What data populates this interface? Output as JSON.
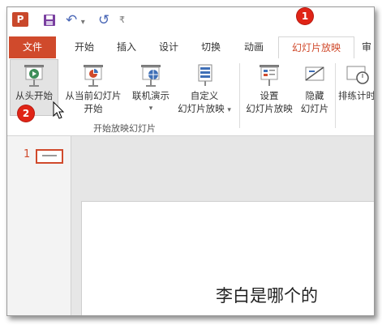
{
  "qat": {
    "logo": "P",
    "undo": "↶",
    "undo_drop": "▾",
    "redo": "↺",
    "customize": "₹"
  },
  "tabs": [
    "文件",
    "开始",
    "插入",
    "设计",
    "切换",
    "动画",
    "幻灯片放映",
    "审"
  ],
  "ribbon": {
    "from_start": "从头开始",
    "from_current_1": "从当前幻灯片",
    "from_current_2": "开始",
    "online_present": "联机演示",
    "online_drop": "▾",
    "custom_1": "自定义",
    "custom_2": "幻灯片放映",
    "custom_drop": "▾",
    "setup_1": "设置",
    "setup_2": "幻灯片放映",
    "hide_1": "隐藏",
    "hide_2": "幻灯片",
    "rehearse": "排练计时",
    "group_label": "开始放映幻灯片"
  },
  "thumbs": {
    "slide_number": "1"
  },
  "slide": {
    "title": "李白是哪个的"
  },
  "badges": [
    "1",
    "2"
  ],
  "colors": {
    "accent": "#d04a2c",
    "badge": "#e02416"
  }
}
